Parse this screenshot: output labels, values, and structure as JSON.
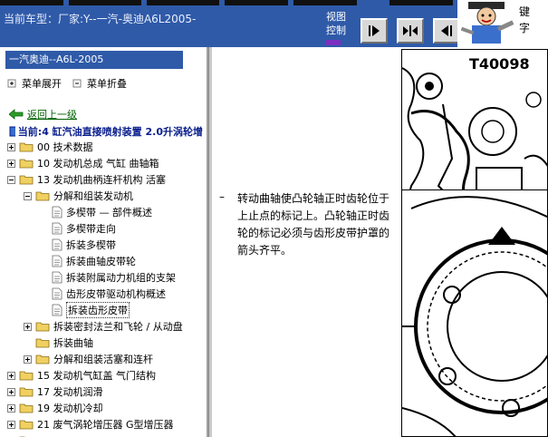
{
  "header": {
    "vehicle_label": "当前车型：厂家:Y--一汽-奥迪A6L2005-",
    "view_control_label": "视图控制",
    "logo_text": "键\n字",
    "nav_buttons": [
      {
        "icon": "arrow-right-icon"
      },
      {
        "icon": "collapse-panels-icon"
      },
      {
        "icon": "arrow-left-icon"
      }
    ]
  },
  "sidebar": {
    "title": "一汽奥迪--A6L-2005",
    "expand_label": "菜单展开",
    "collapse_label": "菜单折叠",
    "back_label": "返回上一级",
    "current_label": "当前:4 缸汽油直接喷射装置 2.0升涡轮增",
    "tree": [
      {
        "level": 0,
        "expander": "plus",
        "icon": "folder",
        "label": "00 技术数据"
      },
      {
        "level": 0,
        "expander": "plus",
        "icon": "folder",
        "label": "10 发动机总成 气缸 曲轴箱"
      },
      {
        "level": 0,
        "expander": "minus",
        "icon": "folder",
        "label": "13 发动机曲柄连杆机构 活塞"
      },
      {
        "level": 1,
        "expander": "minus",
        "icon": "folder",
        "label": "分解和组装发动机"
      },
      {
        "level": 2,
        "expander": "none",
        "icon": "doc",
        "label": "多楔带 — 部件概述"
      },
      {
        "level": 2,
        "expander": "none",
        "icon": "doc",
        "label": "多楔带走向"
      },
      {
        "level": 2,
        "expander": "none",
        "icon": "doc",
        "label": "拆装多楔带"
      },
      {
        "level": 2,
        "expander": "none",
        "icon": "doc",
        "label": "拆装曲轴皮带轮"
      },
      {
        "level": 2,
        "expander": "none",
        "icon": "doc",
        "label": "拆装附属动力机组的支架"
      },
      {
        "level": 2,
        "expander": "none",
        "icon": "doc",
        "label": "齿形皮带驱动机构概述"
      },
      {
        "level": 2,
        "expander": "none",
        "icon": "doc",
        "label": "拆装齿形皮带",
        "selected": true
      },
      {
        "level": 1,
        "expander": "plus",
        "icon": "folder",
        "label": "拆装密封法兰和飞轮 / 从动盘"
      },
      {
        "level": 1,
        "expander": "none",
        "icon": "folder",
        "label": "拆装曲轴"
      },
      {
        "level": 1,
        "expander": "plus",
        "icon": "folder",
        "label": "分解和组装活塞和连杆"
      },
      {
        "level": 0,
        "expander": "plus",
        "icon": "folder",
        "label": "15 发动机气缸盖 气门结构"
      },
      {
        "level": 0,
        "expander": "plus",
        "icon": "folder",
        "label": "17 发动机润滑"
      },
      {
        "level": 0,
        "expander": "plus",
        "icon": "folder",
        "label": "19 发动机冷却"
      },
      {
        "level": 0,
        "expander": "plus",
        "icon": "folder",
        "label": "21 废气涡轮增压器 G型增压器"
      },
      {
        "level": 0,
        "expander": "plus",
        "icon": "folder",
        "label": ""
      }
    ]
  },
  "content": {
    "bullet": "–",
    "instruction": "转动曲轴使凸轮轴正时齿轮位于上止点的标记上。凸轮轴正时齿轮的标记必须与齿形皮带护罩的箭头齐平。",
    "figure1_code": "T40098"
  },
  "colors": {
    "header_bg": "#2f5aa8",
    "title_bar_bg": "#2f5aa8",
    "back_link": "#006000",
    "current_text": "#0a1e8c",
    "folder": "#f0d060"
  }
}
